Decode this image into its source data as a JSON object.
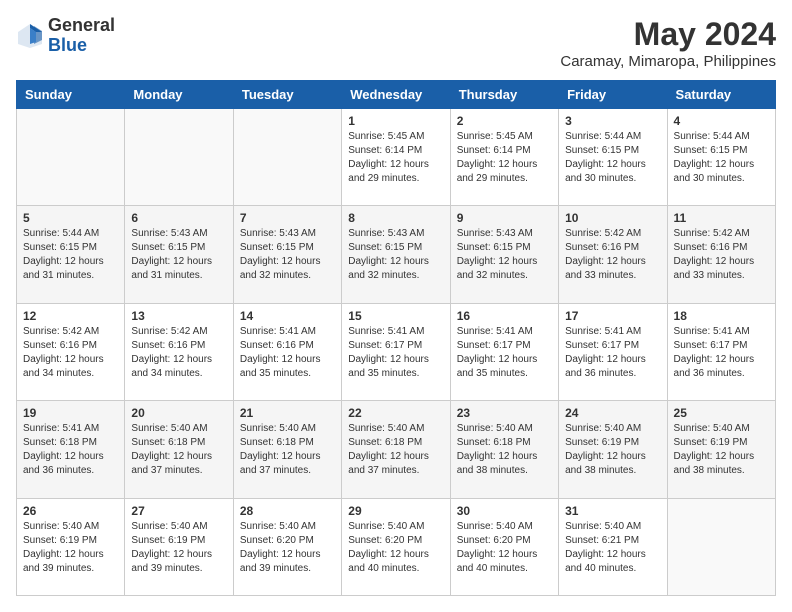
{
  "header": {
    "logo_general": "General",
    "logo_blue": "Blue",
    "title": "May 2024",
    "subtitle": "Caramay, Mimaropa, Philippines"
  },
  "days_of_week": [
    "Sunday",
    "Monday",
    "Tuesday",
    "Wednesday",
    "Thursday",
    "Friday",
    "Saturday"
  ],
  "weeks": [
    [
      {
        "day": "",
        "info": ""
      },
      {
        "day": "",
        "info": ""
      },
      {
        "day": "",
        "info": ""
      },
      {
        "day": "1",
        "info": "Sunrise: 5:45 AM\nSunset: 6:14 PM\nDaylight: 12 hours\nand 29 minutes."
      },
      {
        "day": "2",
        "info": "Sunrise: 5:45 AM\nSunset: 6:14 PM\nDaylight: 12 hours\nand 29 minutes."
      },
      {
        "day": "3",
        "info": "Sunrise: 5:44 AM\nSunset: 6:15 PM\nDaylight: 12 hours\nand 30 minutes."
      },
      {
        "day": "4",
        "info": "Sunrise: 5:44 AM\nSunset: 6:15 PM\nDaylight: 12 hours\nand 30 minutes."
      }
    ],
    [
      {
        "day": "5",
        "info": "Sunrise: 5:44 AM\nSunset: 6:15 PM\nDaylight: 12 hours\nand 31 minutes."
      },
      {
        "day": "6",
        "info": "Sunrise: 5:43 AM\nSunset: 6:15 PM\nDaylight: 12 hours\nand 31 minutes."
      },
      {
        "day": "7",
        "info": "Sunrise: 5:43 AM\nSunset: 6:15 PM\nDaylight: 12 hours\nand 32 minutes."
      },
      {
        "day": "8",
        "info": "Sunrise: 5:43 AM\nSunset: 6:15 PM\nDaylight: 12 hours\nand 32 minutes."
      },
      {
        "day": "9",
        "info": "Sunrise: 5:43 AM\nSunset: 6:15 PM\nDaylight: 12 hours\nand 32 minutes."
      },
      {
        "day": "10",
        "info": "Sunrise: 5:42 AM\nSunset: 6:16 PM\nDaylight: 12 hours\nand 33 minutes."
      },
      {
        "day": "11",
        "info": "Sunrise: 5:42 AM\nSunset: 6:16 PM\nDaylight: 12 hours\nand 33 minutes."
      }
    ],
    [
      {
        "day": "12",
        "info": "Sunrise: 5:42 AM\nSunset: 6:16 PM\nDaylight: 12 hours\nand 34 minutes."
      },
      {
        "day": "13",
        "info": "Sunrise: 5:42 AM\nSunset: 6:16 PM\nDaylight: 12 hours\nand 34 minutes."
      },
      {
        "day": "14",
        "info": "Sunrise: 5:41 AM\nSunset: 6:16 PM\nDaylight: 12 hours\nand 35 minutes."
      },
      {
        "day": "15",
        "info": "Sunrise: 5:41 AM\nSunset: 6:17 PM\nDaylight: 12 hours\nand 35 minutes."
      },
      {
        "day": "16",
        "info": "Sunrise: 5:41 AM\nSunset: 6:17 PM\nDaylight: 12 hours\nand 35 minutes."
      },
      {
        "day": "17",
        "info": "Sunrise: 5:41 AM\nSunset: 6:17 PM\nDaylight: 12 hours\nand 36 minutes."
      },
      {
        "day": "18",
        "info": "Sunrise: 5:41 AM\nSunset: 6:17 PM\nDaylight: 12 hours\nand 36 minutes."
      }
    ],
    [
      {
        "day": "19",
        "info": "Sunrise: 5:41 AM\nSunset: 6:18 PM\nDaylight: 12 hours\nand 36 minutes."
      },
      {
        "day": "20",
        "info": "Sunrise: 5:40 AM\nSunset: 6:18 PM\nDaylight: 12 hours\nand 37 minutes."
      },
      {
        "day": "21",
        "info": "Sunrise: 5:40 AM\nSunset: 6:18 PM\nDaylight: 12 hours\nand 37 minutes."
      },
      {
        "day": "22",
        "info": "Sunrise: 5:40 AM\nSunset: 6:18 PM\nDaylight: 12 hours\nand 37 minutes."
      },
      {
        "day": "23",
        "info": "Sunrise: 5:40 AM\nSunset: 6:18 PM\nDaylight: 12 hours\nand 38 minutes."
      },
      {
        "day": "24",
        "info": "Sunrise: 5:40 AM\nSunset: 6:19 PM\nDaylight: 12 hours\nand 38 minutes."
      },
      {
        "day": "25",
        "info": "Sunrise: 5:40 AM\nSunset: 6:19 PM\nDaylight: 12 hours\nand 38 minutes."
      }
    ],
    [
      {
        "day": "26",
        "info": "Sunrise: 5:40 AM\nSunset: 6:19 PM\nDaylight: 12 hours\nand 39 minutes."
      },
      {
        "day": "27",
        "info": "Sunrise: 5:40 AM\nSunset: 6:19 PM\nDaylight: 12 hours\nand 39 minutes."
      },
      {
        "day": "28",
        "info": "Sunrise: 5:40 AM\nSunset: 6:20 PM\nDaylight: 12 hours\nand 39 minutes."
      },
      {
        "day": "29",
        "info": "Sunrise: 5:40 AM\nSunset: 6:20 PM\nDaylight: 12 hours\nand 40 minutes."
      },
      {
        "day": "30",
        "info": "Sunrise: 5:40 AM\nSunset: 6:20 PM\nDaylight: 12 hours\nand 40 minutes."
      },
      {
        "day": "31",
        "info": "Sunrise: 5:40 AM\nSunset: 6:21 PM\nDaylight: 12 hours\nand 40 minutes."
      },
      {
        "day": "",
        "info": ""
      }
    ]
  ]
}
